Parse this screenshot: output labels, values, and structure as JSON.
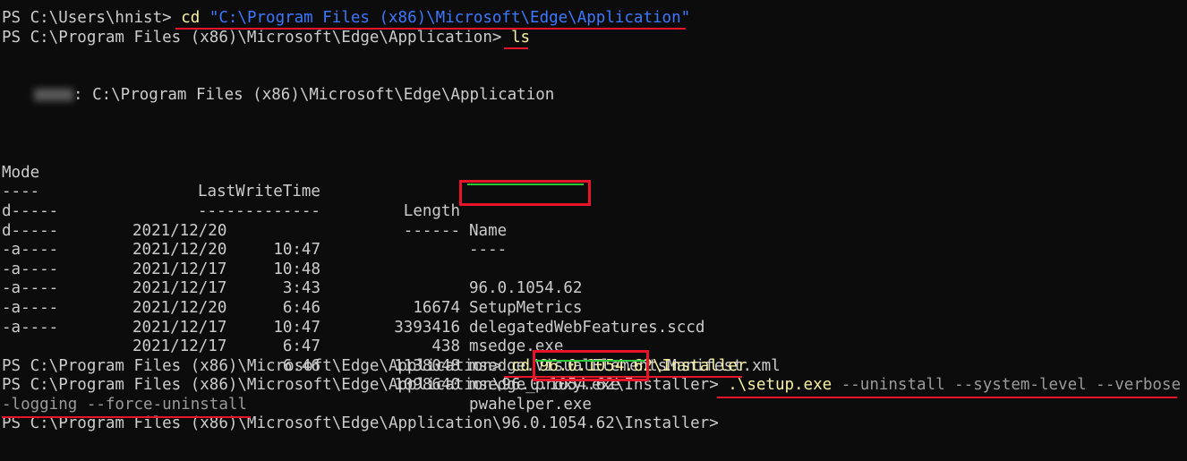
{
  "terminal": {
    "line1": {
      "prompt": "PS C:\\Users\\hnist> ",
      "command": "cd",
      "argument": "\"C:\\Program Files (x86)\\Microsoft\\Edge\\Application\""
    },
    "line2": {
      "prompt": "PS C:\\Program Files (x86)\\Microsoft\\Edge\\Application> ",
      "command": "ls"
    },
    "directory_header": ": C:\\Program Files (x86)\\Microsoft\\Edge\\Application",
    "table": {
      "headers": {
        "mode": "Mode",
        "last_write_time": "LastWriteTime",
        "length": "Length",
        "name": "Name"
      },
      "separators": {
        "mode": "----",
        "last_write_time": "-------------",
        "length": "------",
        "name": "----"
      },
      "rows": [
        {
          "mode": "d-----",
          "date": "2021/12/20",
          "time": "10:47",
          "length": "",
          "name": "96.0.1054.62"
        },
        {
          "mode": "d-----",
          "date": "2021/12/20",
          "time": "10:48",
          "length": "",
          "name": "SetupMetrics"
        },
        {
          "mode": "-a----",
          "date": "2021/12/17",
          "time": "3:43",
          "length": "16674",
          "name": "delegatedWebFeatures.sccd"
        },
        {
          "mode": "-a----",
          "date": "2021/12/17",
          "time": "6:46",
          "length": "3393416",
          "name": "msedge.exe"
        },
        {
          "mode": "-a----",
          "date": "2021/12/20",
          "time": "10:47",
          "length": "438",
          "name": "msedge.VisualElementsManifest.xml"
        },
        {
          "mode": "-a----",
          "date": "2021/12/17",
          "time": "6:47",
          "length": "1138048",
          "name": "msedge_proxy.exe"
        },
        {
          "mode": "-a----",
          "date": "2021/12/17",
          "time": "6:46",
          "length": "1098640",
          "name": "pwahelper.exe"
        }
      ]
    },
    "line3": {
      "prompt": "PS C:\\Program Files (x86)\\Microsoft\\Edge\\Application> ",
      "command": "cd",
      "version": "96.0.1054.62",
      "suffix": "\\Installer"
    },
    "line4": {
      "prompt": "PS C:\\Program Files (x86)\\Microsoft\\Edge\\Application\\96.0.1054.62\\Installer> ",
      "command": ".\\setup.exe",
      "args_part1": " --uninstall --system-level --verbose",
      "args_part2": "-logging --force-uninstall"
    },
    "line5": {
      "prompt": "PS C:\\Program Files (x86)\\Microsoft\\Edge\\Application\\96.0.1054.62\\Installer>"
    }
  },
  "colors": {
    "background": "#0c0c0c",
    "foreground": "#cccccc",
    "command": "#f9f1a5",
    "string": "#3b78ff",
    "parameter": "#9a9a9a",
    "annotation_red": "#e8142a",
    "annotation_green": "#2fc73a"
  }
}
